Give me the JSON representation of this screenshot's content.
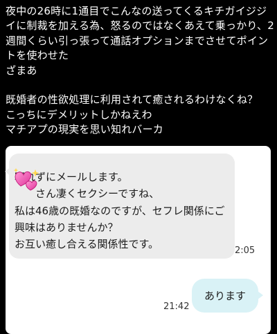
{
  "post": {
    "text": "夜中の26時に1通目でこんなの送ってくるキチガイジジイに制裁を加える為、怒るのではなくあえて乗っかり、2週間くらい引っ張って通話オプションまでさせてポイントを使わせた\nざまあ\n\n既婚者の性欲処理に利用されて癒されるわけなくね？\nこっちにデメリットしかねえわ\nマチアプの現実を思い知れバーカ"
  },
  "chat": {
    "incoming": {
      "text": "寝れずにメールします。\n　　さん凄くセクシーですね、\n私は46歳の既婚なのですが、セフレ関係にご興味はありませんか？\nお互い癒し合える関係性です。",
      "time": "2:05",
      "sticker_icon": "sparkling-hearts-icon"
    },
    "outgoing": {
      "text": "あります",
      "time": "21:42"
    }
  },
  "colors": {
    "background": "#000000",
    "panel": "#ffffff",
    "incoming_bubble": "#ececec",
    "outgoing_bubble": "#d9f2f6",
    "heart_pink": "#ff5fb8"
  }
}
